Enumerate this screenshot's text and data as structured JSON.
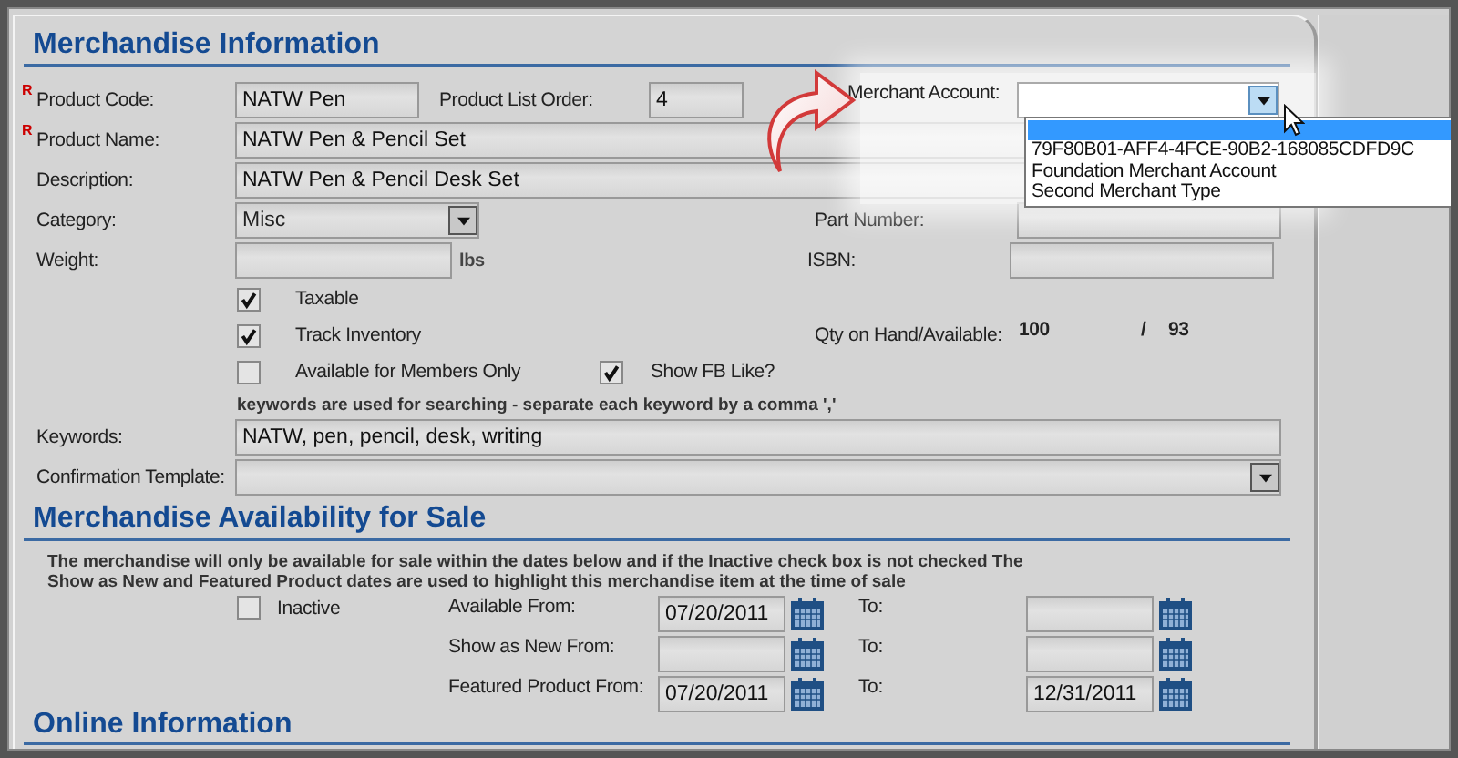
{
  "merchandise_information": {
    "title": "Merchandise Information",
    "product_code": {
      "required_mark": "R",
      "label": "Product Code:",
      "value": "NATW Pen"
    },
    "product_list_order": {
      "label": "Product List Order:",
      "value": "4"
    },
    "merchant_account": {
      "label": "Merchant Account:",
      "expanded": true,
      "blank_option_highlighted": true,
      "options": [
        "79F80B01-AFF4-4FCE-90B2-168085CDFD9C",
        "Foundation Merchant Account",
        "Second Merchant Type"
      ]
    },
    "product_name": {
      "required_mark": "R",
      "label": "Product Name:",
      "value": "NATW Pen & Pencil Set"
    },
    "description": {
      "label": "Description:",
      "value": "NATW Pen & Pencil Desk Set"
    },
    "category": {
      "label": "Category:",
      "value": "Misc"
    },
    "part_number": {
      "label": "Part Number:"
    },
    "weight": {
      "label": "Weight:",
      "unit": "lbs"
    },
    "isbn": {
      "label": "ISBN:"
    },
    "checkboxes": [
      {
        "label": "Taxable",
        "checked": true
      },
      {
        "label": "Track Inventory",
        "checked": true
      },
      {
        "label": "Available for Members Only",
        "checked": false
      },
      {
        "label": "Show FB Like?",
        "checked": true
      }
    ],
    "quantity": {
      "label": "Qty on Hand/Available:",
      "on_hand": "100",
      "separator": "/",
      "available": "93"
    },
    "keywords": {
      "hint": "keywords are used for searching - separate each keyword by a comma ','",
      "label": "Keywords:",
      "value": "NATW, pen, pencil, desk, writing"
    },
    "confirmation_template": {
      "label": "Confirmation Template:"
    }
  },
  "availability": {
    "title": "Merchandise Availability for Sale",
    "note": "The merchandise will only be available for sale within the dates below and if the Inactive check box is not checked The Show as New and Featured Product dates are used to highlight this merchandise item at the time of sale",
    "inactive": {
      "label": "Inactive",
      "checked": false
    },
    "dates": [
      {
        "label": "Available From:",
        "from": "07/20/2011",
        "to_label": "To:"
      },
      {
        "label": "Show as New From:",
        "to_label": "To:"
      },
      {
        "label": "Featured Product From:",
        "from": "07/20/2011",
        "to_label": "To:",
        "to": "12/31/2011"
      }
    ]
  },
  "online_information": {
    "title": "Online Information"
  }
}
